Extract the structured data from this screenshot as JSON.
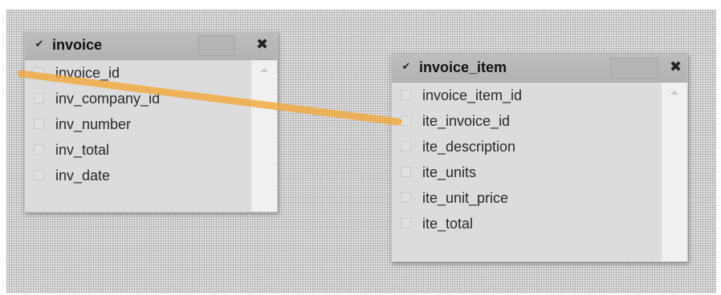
{
  "tables": [
    {
      "title": "invoice",
      "header_check": "✔",
      "close": "✖",
      "fields": [
        "invoice_id",
        "inv_company_id",
        "inv_number",
        "inv_total",
        "inv_date"
      ]
    },
    {
      "title": "invoice_item",
      "header_check": "✔",
      "close": "✖",
      "fields": [
        "invoice_item_id",
        "ite_invoice_id",
        "ite_description",
        "ite_units",
        "ite_unit_price",
        "ite_total"
      ]
    }
  ],
  "colors": {
    "relation_line": "#f3a93a",
    "canvas": "#e6e6e6",
    "header": "#b8b8b8"
  }
}
